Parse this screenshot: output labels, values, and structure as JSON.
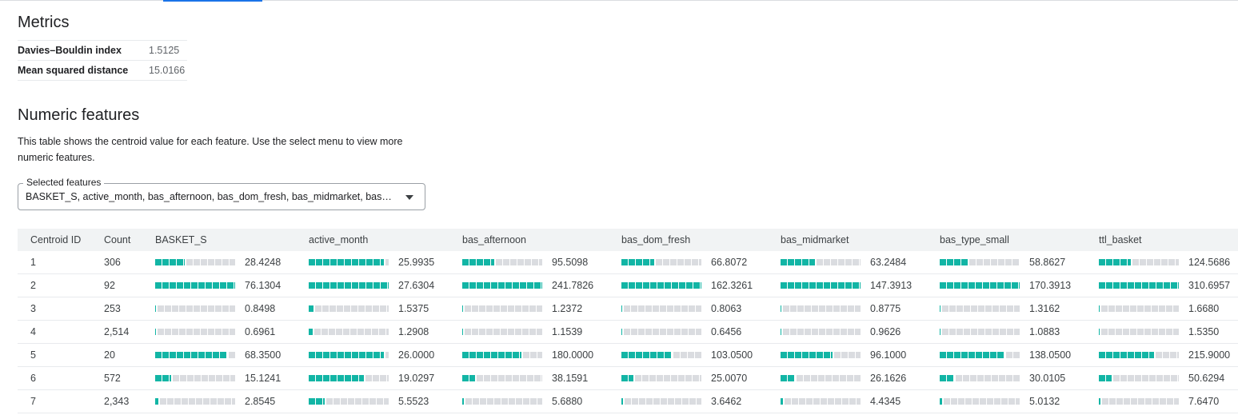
{
  "colors": {
    "accent": "#1a73e8",
    "bar_fill": "#12b5a5",
    "bar_empty": "#dadce0"
  },
  "metrics": {
    "title": "Metrics",
    "rows": [
      {
        "name": "Davies–Bouldin index",
        "value": "1.5125"
      },
      {
        "name": "Mean squared distance",
        "value": "15.0166"
      }
    ]
  },
  "numeric": {
    "title": "Numeric features",
    "description": "This table shows the centroid value for each feature. Use the select menu to view more numeric features.",
    "select": {
      "label": "Selected features",
      "value": "BASKET_S, active_month, bas_afternoon, bas_dom_fresh, bas_midmarket, bas_type_small, ttl_basket",
      "icon": "dropdown-arrow-icon"
    },
    "table": {
      "headers": [
        "Centroid ID",
        "Count",
        "BASKET_S",
        "active_month",
        "bas_afternoon",
        "bas_dom_fresh",
        "bas_midmarket",
        "bas_type_small",
        "ttl_basket"
      ],
      "rows": [
        {
          "id": "1",
          "count": "306",
          "values": [
            "28.4248",
            "25.9935",
            "95.5098",
            "66.8072",
            "63.2484",
            "58.8627",
            "124.5686"
          ],
          "bars": [
            0.37,
            0.94,
            0.4,
            0.41,
            0.43,
            0.35,
            0.4
          ]
        },
        {
          "id": "2",
          "count": "92",
          "values": [
            "76.1304",
            "27.6304",
            "241.7826",
            "162.3261",
            "147.3913",
            "170.3913",
            "310.6957"
          ],
          "bars": [
            1.0,
            1.0,
            1.0,
            1.0,
            1.0,
            1.0,
            1.0
          ]
        },
        {
          "id": "3",
          "count": "253",
          "values": [
            "0.8498",
            "1.5375",
            "1.2372",
            "0.8063",
            "0.8775",
            "1.3162",
            "1.6680"
          ],
          "bars": [
            0.01,
            0.06,
            0.01,
            0.0,
            0.01,
            0.01,
            0.01
          ]
        },
        {
          "id": "4",
          "count": "2,514",
          "values": [
            "0.6961",
            "1.2908",
            "1.1539",
            "0.6456",
            "0.9626",
            "1.0883",
            "1.5350"
          ],
          "bars": [
            0.01,
            0.05,
            0.0,
            0.0,
            0.01,
            0.01,
            0.0
          ]
        },
        {
          "id": "5",
          "count": "20",
          "values": [
            "68.3500",
            "26.0000",
            "180.0000",
            "103.0500",
            "96.1000",
            "138.0500",
            "215.9000"
          ],
          "bars": [
            0.9,
            0.94,
            0.74,
            0.63,
            0.65,
            0.81,
            0.69
          ]
        },
        {
          "id": "6",
          "count": "572",
          "values": [
            "15.1241",
            "19.0297",
            "38.1591",
            "25.0070",
            "26.1626",
            "30.0105",
            "50.6294"
          ],
          "bars": [
            0.2,
            0.69,
            0.16,
            0.15,
            0.18,
            0.18,
            0.16
          ]
        },
        {
          "id": "7",
          "count": "2,343",
          "values": [
            "2.8545",
            "5.5523",
            "5.6880",
            "3.6462",
            "4.4345",
            "5.0132",
            "7.6470"
          ],
          "bars": [
            0.04,
            0.2,
            0.02,
            0.02,
            0.03,
            0.03,
            0.02
          ]
        }
      ]
    }
  }
}
